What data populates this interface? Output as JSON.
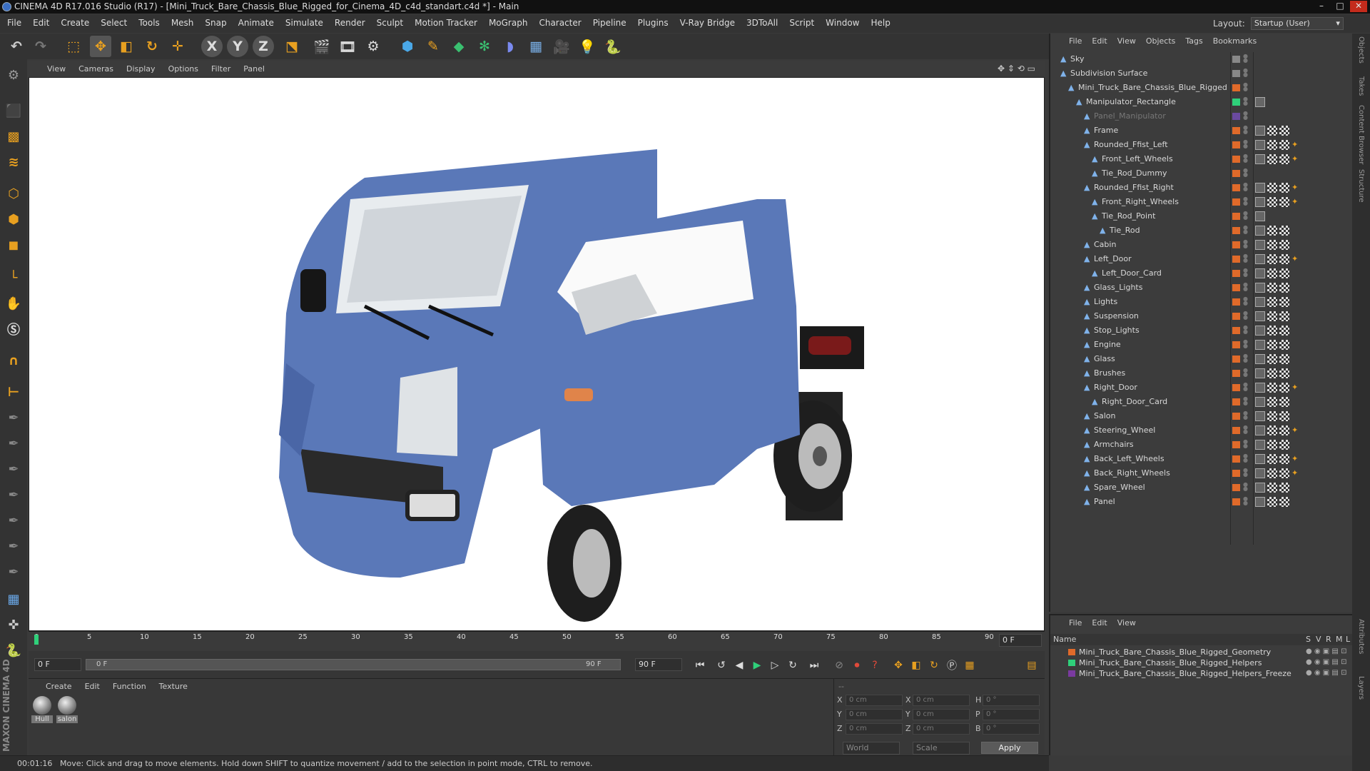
{
  "window": {
    "title": "CINEMA 4D R17.016 Studio (R17) - [Mini_Truck_Bare_Chassis_Blue_Rigged_for_Cinema_4D_c4d_standart.c4d *] - Main",
    "min": "–",
    "max": "□",
    "close": "✕"
  },
  "menubar": {
    "items": [
      "File",
      "Edit",
      "Create",
      "Select",
      "Tools",
      "Mesh",
      "Snap",
      "Animate",
      "Simulate",
      "Render",
      "Sculpt",
      "Motion Tracker",
      "MoGraph",
      "Character",
      "Pipeline",
      "Plugins",
      "V-Ray Bridge",
      "3DToAll",
      "Script",
      "Window",
      "Help"
    ],
    "layout_label": "Layout:",
    "layout_value": "Startup (User)"
  },
  "toolbar": {
    "x_axis": "X",
    "y_axis": "Y",
    "z_axis": "Z"
  },
  "viewport": {
    "menu": [
      "View",
      "Cameras",
      "Display",
      "Options",
      "Filter",
      "Panel"
    ]
  },
  "timeline": {
    "ticks": [
      "0",
      "5",
      "10",
      "15",
      "20",
      "25",
      "30",
      "35",
      "40",
      "45",
      "50",
      "55",
      "60",
      "65",
      "70",
      "75",
      "80",
      "85",
      "90"
    ],
    "end_frame": "0 F",
    "current_frame": "0 F",
    "range_start": "0 F",
    "range_end": "90 F",
    "max_frame": "90 F"
  },
  "materials": {
    "menu": [
      "Create",
      "Edit",
      "Function",
      "Texture"
    ],
    "items": [
      {
        "name": "Hull"
      },
      {
        "name": "salon"
      }
    ]
  },
  "coordinates": {
    "rows": [
      {
        "a": "X",
        "av": "0 cm",
        "b": "X",
        "bv": "0 cm",
        "c": "H",
        "cv": "0 °"
      },
      {
        "a": "Y",
        "av": "0 cm",
        "b": "Y",
        "bv": "0 cm",
        "c": "P",
        "cv": "0 °"
      },
      {
        "a": "Z",
        "av": "0 cm",
        "b": "Z",
        "bv": "0 cm",
        "c": "B",
        "cv": "0 °"
      }
    ],
    "mode1": "World",
    "mode2": "Scale",
    "apply": "Apply"
  },
  "status": {
    "time": "00:01:16",
    "message": "Move: Click and drag to move elements. Hold down SHIFT to quantize movement / add to the selection in point mode, CTRL to remove."
  },
  "object_manager": {
    "menu": [
      "File",
      "Edit",
      "View",
      "Objects",
      "Tags",
      "Bookmarks"
    ],
    "objects": [
      {
        "name": "Sky",
        "depth": 0,
        "color": "#888888",
        "tags": 0
      },
      {
        "name": "Subdivision Surface",
        "depth": 0,
        "color": "#888888",
        "tags": 0
      },
      {
        "name": "Mini_Truck_Bare_Chassis_Blue_Rigged",
        "depth": 1,
        "color": "#e06a2a",
        "tags": 0
      },
      {
        "name": "Manipulator_Rectangle",
        "depth": 2,
        "color": "#2fd07a",
        "tags": 1
      },
      {
        "name": "Panel_Manipulator",
        "depth": 3,
        "color": "#6a4aa0",
        "tags": 0
      },
      {
        "name": "Frame",
        "depth": 3,
        "color": "#e06a2a",
        "tags": 3
      },
      {
        "name": "Rounded_Ffist_Left",
        "depth": 3,
        "color": "#e06a2a",
        "tags": 4
      },
      {
        "name": "Front_Left_Wheels",
        "depth": 4,
        "color": "#e06a2a",
        "tags": 4
      },
      {
        "name": "Tie_Rod_Dummy",
        "depth": 4,
        "color": "#e06a2a",
        "tags": 0
      },
      {
        "name": "Rounded_Ffist_Right",
        "depth": 3,
        "color": "#e06a2a",
        "tags": 4
      },
      {
        "name": "Front_Right_Wheels",
        "depth": 4,
        "color": "#e06a2a",
        "tags": 4
      },
      {
        "name": "Tie_Rod_Point",
        "depth": 4,
        "color": "#e06a2a",
        "tags": 1
      },
      {
        "name": "Tie_Rod",
        "depth": 5,
        "color": "#e06a2a",
        "tags": 3
      },
      {
        "name": "Cabin",
        "depth": 3,
        "color": "#e06a2a",
        "tags": 3
      },
      {
        "name": "Left_Door",
        "depth": 3,
        "color": "#e06a2a",
        "tags": 4
      },
      {
        "name": "Left_Door_Card",
        "depth": 4,
        "color": "#e06a2a",
        "tags": 3
      },
      {
        "name": "Glass_Lights",
        "depth": 3,
        "color": "#e06a2a",
        "tags": 3
      },
      {
        "name": "Lights",
        "depth": 3,
        "color": "#e06a2a",
        "tags": 3
      },
      {
        "name": "Suspension",
        "depth": 3,
        "color": "#e06a2a",
        "tags": 3
      },
      {
        "name": "Stop_Lights",
        "depth": 3,
        "color": "#e06a2a",
        "tags": 3
      },
      {
        "name": "Engine",
        "depth": 3,
        "color": "#e06a2a",
        "tags": 3
      },
      {
        "name": "Glass",
        "depth": 3,
        "color": "#e06a2a",
        "tags": 3
      },
      {
        "name": "Brushes",
        "depth": 3,
        "color": "#e06a2a",
        "tags": 3
      },
      {
        "name": "Right_Door",
        "depth": 3,
        "color": "#e06a2a",
        "tags": 4
      },
      {
        "name": "Right_Door_Card",
        "depth": 4,
        "color": "#e06a2a",
        "tags": 3
      },
      {
        "name": "Salon",
        "depth": 3,
        "color": "#e06a2a",
        "tags": 3
      },
      {
        "name": "Steering_Wheel",
        "depth": 3,
        "color": "#e06a2a",
        "tags": 4
      },
      {
        "name": "Armchairs",
        "depth": 3,
        "color": "#e06a2a",
        "tags": 3
      },
      {
        "name": "Back_Left_Wheels",
        "depth": 3,
        "color": "#e06a2a",
        "tags": 4
      },
      {
        "name": "Back_Right_Wheels",
        "depth": 3,
        "color": "#e06a2a",
        "tags": 4
      },
      {
        "name": "Spare_Wheel",
        "depth": 3,
        "color": "#e06a2a",
        "tags": 3
      },
      {
        "name": "Panel",
        "depth": 3,
        "color": "#e06a2a",
        "tags": 3
      }
    ]
  },
  "layer_manager": {
    "menu": [
      "File",
      "Edit",
      "View"
    ],
    "header": {
      "name": "Name",
      "cols": [
        "S",
        "V",
        "R",
        "M",
        "L"
      ]
    },
    "layers": [
      {
        "name": "Mini_Truck_Bare_Chassis_Blue_Rigged_Geometry",
        "color": "#e06a2a"
      },
      {
        "name": "Mini_Truck_Bare_Chassis_Blue_Rigged_Helpers",
        "color": "#2fd07a"
      },
      {
        "name": "Mini_Truck_Bare_Chassis_Blue_Rigged_Helpers_Freeze",
        "color": "#7a3aa0"
      }
    ]
  },
  "side_tabs": [
    "Objects",
    "Takes",
    "Content Browser",
    "Structure",
    "Attributes",
    "Layers"
  ],
  "brand": "MAXON CINEMA 4D"
}
